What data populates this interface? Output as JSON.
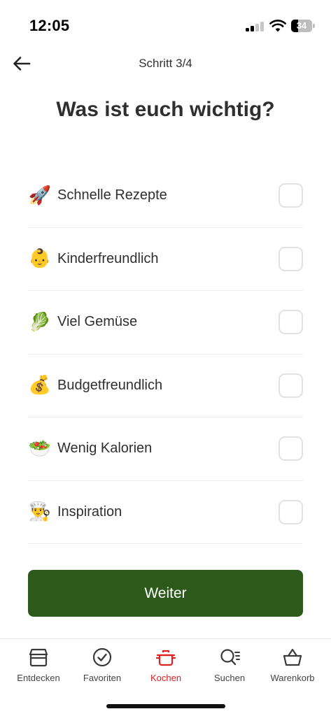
{
  "status_bar": {
    "time": "12:05",
    "battery_level": "34",
    "battery_fraction": 0.34
  },
  "header": {
    "back_icon": "arrow-left-icon",
    "step_label": "Schritt 3/4"
  },
  "title": "Was ist euch wichtig?",
  "options": [
    {
      "emoji": "🚀",
      "label": "Schnelle Rezepte",
      "checked": false
    },
    {
      "emoji": "👶",
      "label": "Kinderfreundlich",
      "checked": false
    },
    {
      "emoji": "🥬",
      "label": "Viel Gemüse",
      "checked": false
    },
    {
      "emoji": "💰",
      "label": "Budgetfreundlich",
      "checked": false
    },
    {
      "emoji": "🥗",
      "label": "Wenig Kalorien",
      "checked": false
    },
    {
      "emoji": "👨‍🍳",
      "label": "Inspiration",
      "checked": false
    }
  ],
  "continue_button": "Weiter",
  "tabs": [
    {
      "label": "Entdecken",
      "icon": "shop-icon",
      "active": false
    },
    {
      "label": "Favoriten",
      "icon": "check-circle-icon",
      "active": false
    },
    {
      "label": "Kochen",
      "icon": "cooking-pot-icon",
      "active": true
    },
    {
      "label": "Suchen",
      "icon": "search-list-icon",
      "active": false
    },
    {
      "label": "Warenkorb",
      "icon": "basket-icon",
      "active": false
    }
  ],
  "colors": {
    "primary_green": "#2d5a1b",
    "active_tab": "#e02020",
    "text": "#2f2f2f"
  }
}
